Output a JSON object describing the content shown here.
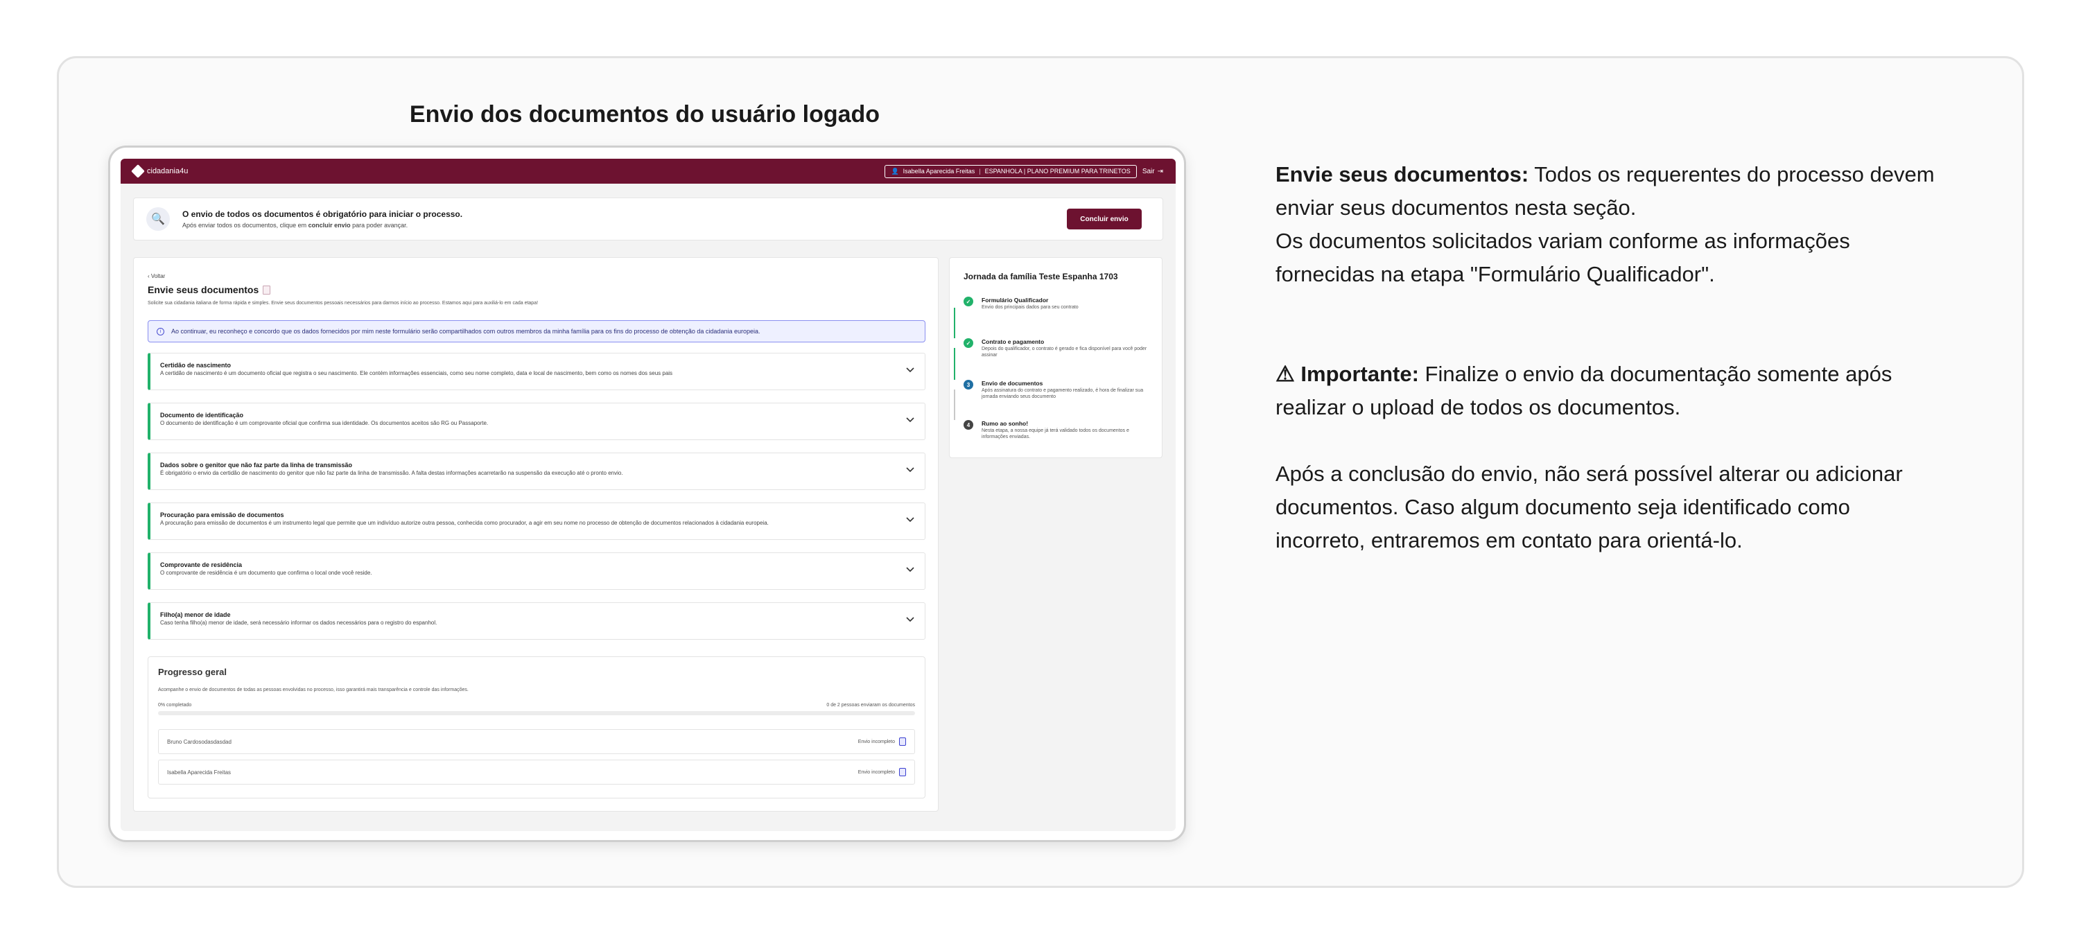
{
  "frame_title": "Envio dos documentos do usuário logado",
  "topbar": {
    "logo": "cidadania4u",
    "user_name": "Isabella Aparecida Freitas",
    "plan": "ESPANHOLA | PLANO PREMIUM PARA TRINETOS",
    "logout": "Sair"
  },
  "notice": {
    "title": "O envio de todos os documentos é obrigatório para iniciar o processo.",
    "sub_prefix": "Após enviar todos os documentos, clique em ",
    "sub_bold": "concluir envio",
    "sub_suffix": " para poder avançar.",
    "button": "Concluir envio"
  },
  "page": {
    "back": "Voltar",
    "title": "Envie seus documentos",
    "subtitle": "Solicite sua cidadania italiana de forma rápida e simples. Envie seus documentos pessoais necessários para darmos início ao processo. Estamos aqui para auxiliá-lo em cada etapa!",
    "consent": "Ao continuar, eu reconheço e concordo que os dados fornecidos por mim neste formulário serão compartilhados com outros membros da minha família para os fins do processo de obtenção da cidadania europeia."
  },
  "documents": [
    {
      "title": "Certidão de nascimento",
      "desc": "A certidão de nascimento é um documento oficial que registra o seu nascimento. Ele contém informações essenciais, como seu nome completo, data e local de nascimento, bem como os nomes dos seus pais"
    },
    {
      "title": "Documento de identificação",
      "desc": "O documento de identificação é um comprovante oficial que confirma sua identidade. Os documentos aceitos são RG ou Passaporte."
    },
    {
      "title": "Dados sobre o genitor que não faz parte da linha de transmissão",
      "desc": "É obrigatório o envio da certidão de nascimento do genitor que não faz parte da linha de transmissão. A falta destas informações acarretarão na suspensão da execução até o pronto envio."
    },
    {
      "title": "Procuração para emissão de documentos",
      "desc": "A procuração para emissão de documentos é um instrumento legal que permite que um indivíduo autorize outra pessoa, conhecida como procurador, a agir em seu nome no processo de obtenção de documentos relacionados à cidadania europeia."
    },
    {
      "title": "Comprovante de residência",
      "desc": "O comprovante de residência é um documento que confirma o local onde você reside."
    },
    {
      "title": "Filho(a) menor de idade",
      "desc": "Caso tenha filho(a) menor de idade, será necessário informar os dados necessários para o registro do espanhol."
    }
  ],
  "progress": {
    "title": "Progresso geral",
    "desc": "Acompanhe o envio de documentos de todas as pessoas envolvidas no processo, isso garantirá mais transparência e controle das informações.",
    "left": "0% completado",
    "right": "0 de 2 pessoas enviaram os documentos",
    "fraction": 0,
    "people": [
      {
        "name": "Bruno Cardosodasdasdad",
        "status": "Envio incompleto"
      },
      {
        "name": "Isabella Aparecida Freitas",
        "status": "Envio incompleto"
      }
    ]
  },
  "journey": {
    "title": "Jornada da família Teste Espanha 1703",
    "steps": [
      {
        "marker": "✓",
        "title": "Formulário Qualificador",
        "desc": "Envio dos principais dados para seu contrato"
      },
      {
        "marker": "✓",
        "title": "Contrato e pagamento",
        "desc": "Depois do qualificador, o contrato é gerado e fica disponível para você poder assinar"
      },
      {
        "marker": "3",
        "title": "Envio de documentos",
        "desc": "Após assinatura do contrato e pagamento realizado, é hora de finalizar sua jornada enviando seus documento"
      },
      {
        "marker": "4",
        "title": "Rumo ao sonho!",
        "desc": "Nesta etapa, a nossa equipe já terá validado todos os documentos e informações enviadas."
      }
    ]
  },
  "explain": {
    "p1_bold": "Envie seus documentos:",
    "p1_text": " Todos os requerentes do processo devem enviar seus documentos nesta seção.",
    "p1_line2": "Os documentos solicitados variam conforme as informações fornecidas na etapa \"Formulário Qualificador\".",
    "p2_bold": "⚠ Importante:",
    "p2_text": "  Finalize o envio da documentação somente após realizar o upload de todos os documentos.",
    "p3_text": "Após a conclusão do envio, não será possível alterar ou adicionar documentos. Caso algum documento seja identificado como incorreto, entraremos em contato para orientá-lo."
  }
}
